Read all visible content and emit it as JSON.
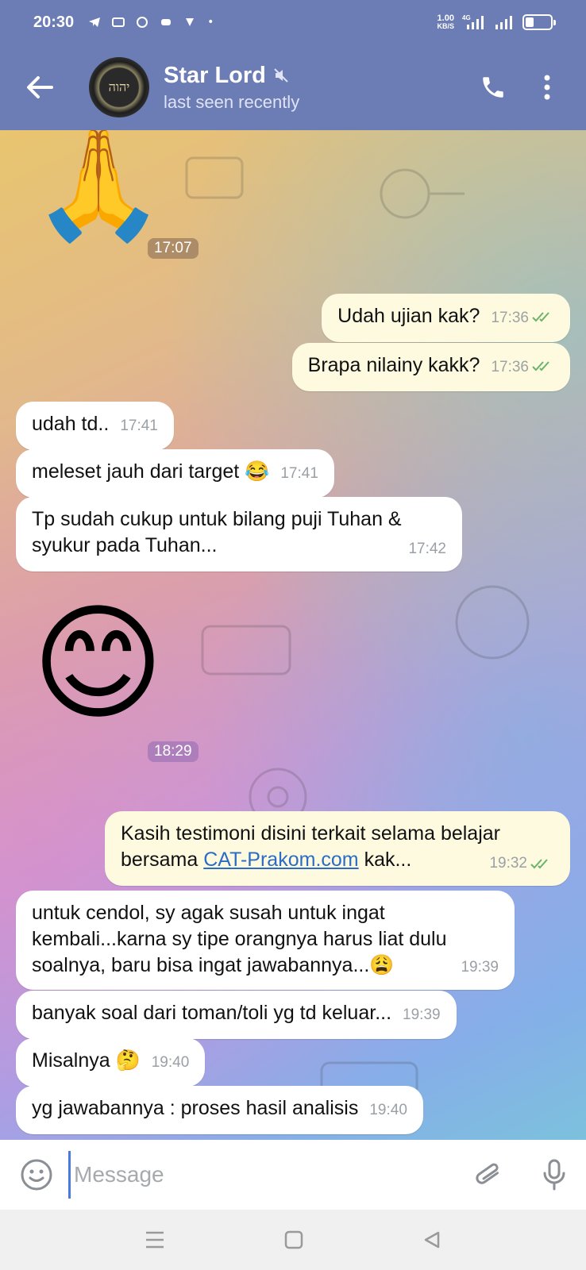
{
  "status_bar": {
    "time": "20:30",
    "net_speed_value": "1.00",
    "net_speed_unit": "KB/S",
    "network": "4G"
  },
  "header": {
    "contact_name": "Star Lord",
    "status": "last seen recently",
    "avatar_text": "יהוה"
  },
  "messages": [
    {
      "type": "sticker",
      "emoji": "🙏",
      "time": "17:07"
    },
    {
      "direction": "out",
      "text": "Udah ujian kak?",
      "time": "17:36"
    },
    {
      "direction": "out",
      "text": "Brapa nilainy kakk?",
      "time": "17:36"
    },
    {
      "direction": "in",
      "text": "udah td..",
      "time": "17:41"
    },
    {
      "direction": "in",
      "text": "meleset jauh dari target 😂",
      "time": "17:41"
    },
    {
      "direction": "in",
      "text": "Tp sudah cukup untuk bilang puji Tuhan & syukur pada Tuhan...",
      "time": "17:42"
    },
    {
      "type": "sticker",
      "emoji": "😊",
      "time": "18:29"
    },
    {
      "direction": "out",
      "text_before_link": "Kasih testimoni disini terkait selama belajar bersama ",
      "link": "CAT-Prakom.com",
      "text_after_link": " kak...",
      "time": "19:32"
    },
    {
      "direction": "in",
      "text": "untuk cendol, sy agak susah untuk ingat kembali...karna sy tipe orangnya harus liat dulu soalnya, baru bisa ingat jawabannya...😩",
      "time": "19:39"
    },
    {
      "direction": "in",
      "text": "banyak soal dari toman/toli yg td keluar...",
      "time": "19:39"
    },
    {
      "direction": "in",
      "text": "Misalnya 🤔",
      "time": "19:40"
    },
    {
      "direction": "in",
      "text": "yg jawabannya : proses hasil analisis",
      "time": "19:40"
    }
  ],
  "input": {
    "placeholder": "Message"
  },
  "colors": {
    "header": "#6c7cb4",
    "outgoing_bubble": "#fdfae0",
    "incoming_bubble": "#ffffff",
    "link": "#2a6cc6",
    "read_ticks": "#6bb36b"
  }
}
